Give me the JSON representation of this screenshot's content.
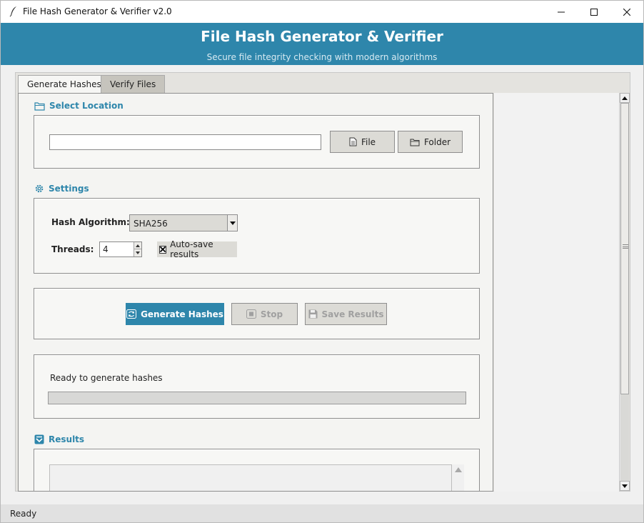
{
  "window": {
    "title": "File Hash Generator & Verifier v2.0",
    "controls": [
      "minimize-icon",
      "maximize-icon",
      "close-icon"
    ]
  },
  "header": {
    "title": "File Hash Generator & Verifier",
    "subtitle": "Secure file integrity checking with modern algorithms"
  },
  "tabs": [
    {
      "label": "Generate Hashes",
      "active": true
    },
    {
      "label": "Verify Files",
      "active": false
    }
  ],
  "select_location": {
    "label": "Select Location",
    "icon": "folder-icon",
    "path_value": "",
    "file_button": "File",
    "folder_button": "Folder"
  },
  "settings": {
    "label": "Settings",
    "icon": "gear-icon",
    "algorithm_label": "Hash Algorithm:",
    "algorithm_value": "SHA256",
    "threads_label": "Threads:",
    "threads_value": "4",
    "autosave_label": "Auto-save results",
    "autosave_checked": true
  },
  "actions": {
    "generate": "Generate Hashes",
    "stop": "Stop",
    "save": "Save Results"
  },
  "progress": {
    "status": "Ready to generate hashes",
    "value": 0
  },
  "results": {
    "label": "Results",
    "icon": "results-box-icon",
    "text": ""
  },
  "statusbar": {
    "text": "Ready"
  },
  "colors": {
    "accent": "#2e86ab",
    "header_text": "#ffffff",
    "disabled_text": "#a0a0a0"
  }
}
